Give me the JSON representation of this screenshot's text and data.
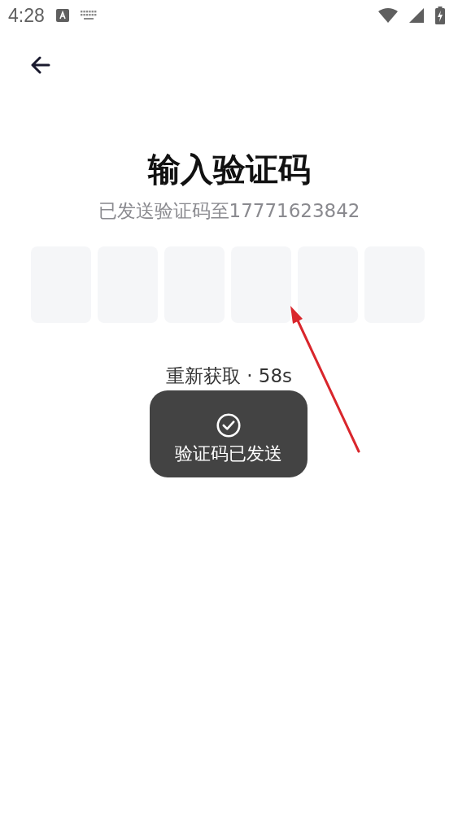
{
  "status_bar": {
    "time": "4:28"
  },
  "header": {
    "back": true
  },
  "title": "输入验证码",
  "subtitle": "已发送验证码至17771623842",
  "code_boxes": [
    {
      "kind": "digit"
    },
    {
      "kind": "digit"
    },
    {
      "kind": "digit"
    },
    {
      "kind": "digit"
    },
    {
      "kind": "digit"
    },
    {
      "kind": "digit"
    }
  ],
  "resend": "重新获取 · 58s",
  "toast": {
    "kind": "success",
    "text": "验证码已发送"
  },
  "annotation": {
    "kind": "arrow"
  }
}
